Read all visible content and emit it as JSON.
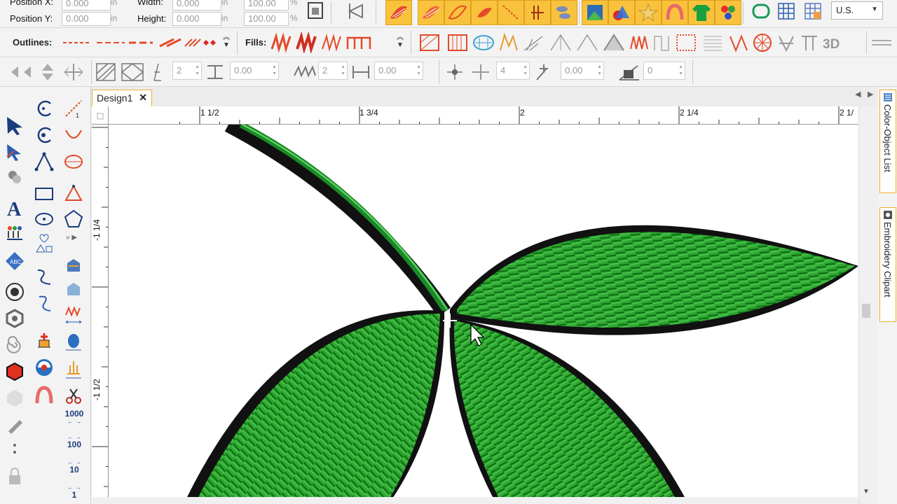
{
  "props": {
    "position_x_label": "Position X:",
    "position_x_value": "0.000",
    "position_y_label": "Position Y:",
    "position_y_value": "0.000",
    "width_label": "Width:",
    "width_value": "0.000",
    "height_label": "Height:",
    "height_value": "0.000",
    "scale_w_value": "100.00",
    "scale_h_value": "100.00",
    "unit_in": "in",
    "unit_pct": "%"
  },
  "units_select": {
    "value": "U.S."
  },
  "outlines_label": "Outlines:",
  "fills_label": "Fills:",
  "fills_extra": "3D",
  "row3": {
    "spin1": "2",
    "spin2": "0.00",
    "spin3": "2",
    "spin4": "0.00",
    "spin5": "4",
    "spin6": "0.00",
    "spin7": "0",
    "in1": "in",
    "in2": "in",
    "in3": "in"
  },
  "document_tab": {
    "title": "Design1",
    "close": "✕"
  },
  "ruler": {
    "top_labels": [
      "1 1/2",
      "1 3/4",
      "2",
      "2 1/4",
      "2 1/"
    ],
    "left_labels": [
      "-1 1/4",
      "-1 1/2"
    ]
  },
  "toolbox_numbers": [
    "1000",
    "100",
    "10",
    "1"
  ],
  "dock_tabs": [
    "Color-Object List",
    "Embroidery Clipart"
  ],
  "accent_colors": {
    "orange": "#f9c23c",
    "tab_border": "#f0b030",
    "stitch_green": "#2ea832",
    "stitch_dark": "#0d6a12"
  }
}
